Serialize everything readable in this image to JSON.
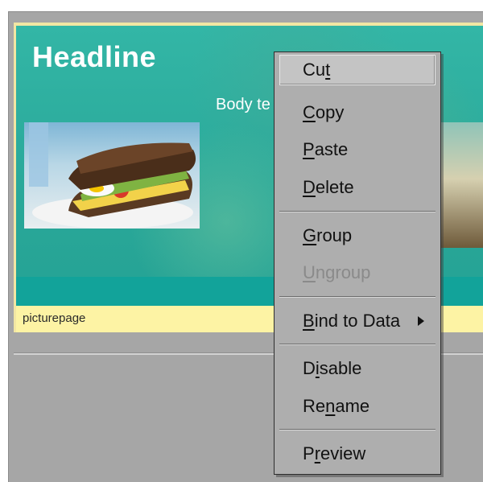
{
  "canvas": {
    "headline": "Headline",
    "body_text": "Body te",
    "caption": "picturepage"
  },
  "context_menu": {
    "items": [
      {
        "pre": "Cu",
        "key": "t",
        "post": "",
        "state": "hover"
      },
      {
        "pre": "",
        "key": "C",
        "post": "opy",
        "state": "normal"
      },
      {
        "pre": "",
        "key": "P",
        "post": "aste",
        "state": "normal"
      },
      {
        "pre": "",
        "key": "D",
        "post": "elete",
        "state": "normal"
      },
      {
        "pre": "",
        "key": "G",
        "post": "roup",
        "state": "normal"
      },
      {
        "pre": "",
        "key": "U",
        "post": "ngroup",
        "state": "disabled"
      },
      {
        "pre": "",
        "key": "B",
        "post": "ind to Data",
        "state": "submenu"
      },
      {
        "pre": "D",
        "key": "i",
        "post": "sable",
        "state": "normal"
      },
      {
        "pre": "Re",
        "key": "n",
        "post": "ame",
        "state": "normal"
      },
      {
        "pre": "P",
        "key": "r",
        "post": "eview",
        "state": "normal"
      }
    ]
  },
  "colors": {
    "canvas_teal": "#2aa99a",
    "caption_yellow": "#fdf3a4",
    "menu_gray": "#aeaeae",
    "workspace_gray": "#a6a6a6"
  }
}
